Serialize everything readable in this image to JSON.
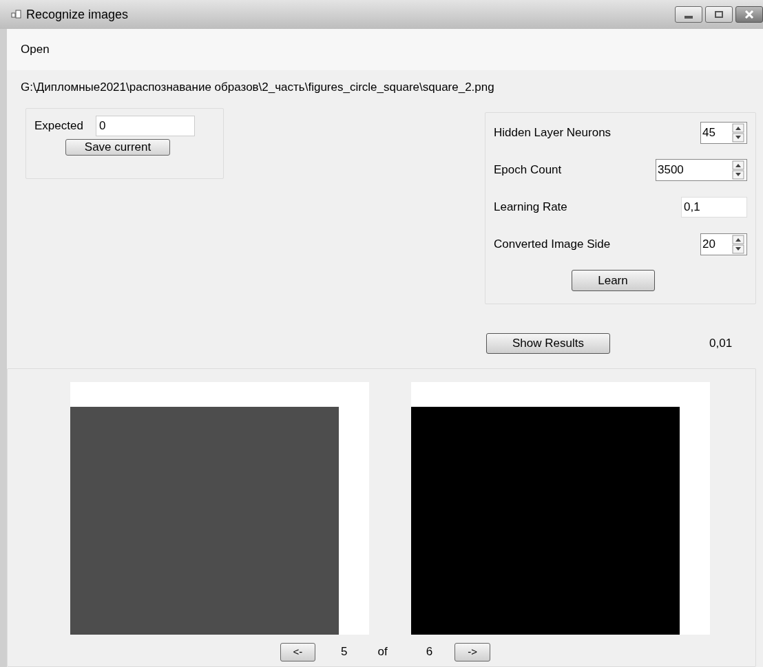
{
  "window": {
    "title": "Recognize images"
  },
  "menu": [
    "Open"
  ],
  "file_path": "G:\\Дипломные2021\\распознавание образов\\2_часть\\figures_circle_square\\square_2.png",
  "expected": {
    "label": "Expected",
    "value": "0",
    "button": "Save current"
  },
  "parameters": [
    {
      "kind": "spinner",
      "label": "Hidden Layer Neurons",
      "value": "45"
    },
    {
      "kind": "spinner",
      "label": "Epoch Count",
      "value": "3500"
    },
    {
      "kind": "text",
      "label": "Learning Rate",
      "value": "0,1"
    },
    {
      "kind": "spinner",
      "label": "Converted Image Side",
      "value": "20"
    }
  ],
  "learn_button": "Learn",
  "show_results_button": "Show Results",
  "result": "0,01",
  "images": [
    {
      "color": "#4d4d4d"
    },
    {
      "color": "#000000"
    }
  ],
  "navigation": {
    "prev": "<-",
    "current": "5",
    "of": "of",
    "total": "6",
    "next": "->"
  }
}
